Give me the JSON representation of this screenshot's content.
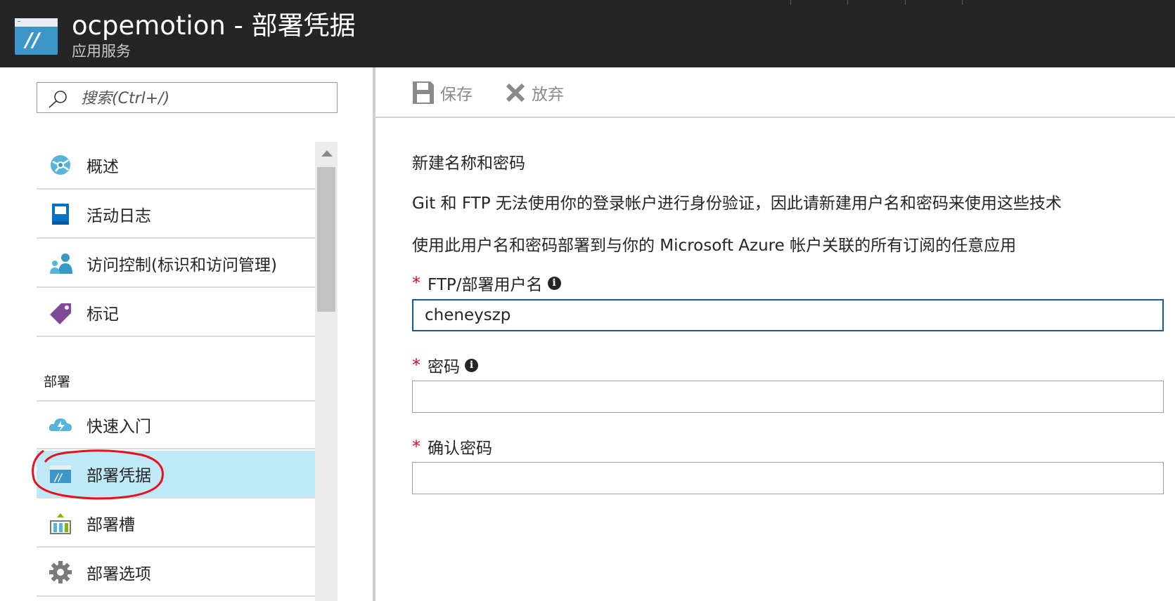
{
  "header": {
    "title": "ocpemotion - 部署凭据",
    "subtitle": "应用服务"
  },
  "search": {
    "placeholder": "搜索(Ctrl+/)"
  },
  "sidebar": {
    "items": [
      {
        "label": "概述",
        "icon": "globe-icon"
      },
      {
        "label": "活动日志",
        "icon": "log-book-icon"
      },
      {
        "label": "访问控制(标识和访问管理)",
        "icon": "users-icon"
      },
      {
        "label": "标记",
        "icon": "tag-icon"
      }
    ],
    "section_label": "部署",
    "deploy_items": [
      {
        "label": "快速入门",
        "icon": "cloud-bolt-icon"
      },
      {
        "label": "部署凭据",
        "icon": "app-service-icon",
        "active": true
      },
      {
        "label": "部署槽",
        "icon": "deployment-slots-icon"
      },
      {
        "label": "部署选项",
        "icon": "gear-icon"
      }
    ]
  },
  "toolbar": {
    "save_label": "保存",
    "discard_label": "放弃"
  },
  "content": {
    "title": "新建名称和密码",
    "description1": "Git 和 FTP 无法使用你的登录帐户进行身份验证，因此请新建用户名和密码来使用这些技术",
    "description2": "使用此用户名和密码部署到与你的 Microsoft Azure 帐户关联的所有订阅的任意应用"
  },
  "form": {
    "required_mark": "*",
    "username_label": "FTP/部署用户名",
    "username_value": "cheneyszp",
    "password_label": "密码",
    "password_value": "",
    "confirm_label": "确认密码",
    "confirm_value": ""
  },
  "colors": {
    "header_bg": "#252525",
    "active_item_bg": "#bfe9f6",
    "required": "#e00b1c",
    "focus_border": "#105e8f",
    "annotation": "#e8101a"
  }
}
